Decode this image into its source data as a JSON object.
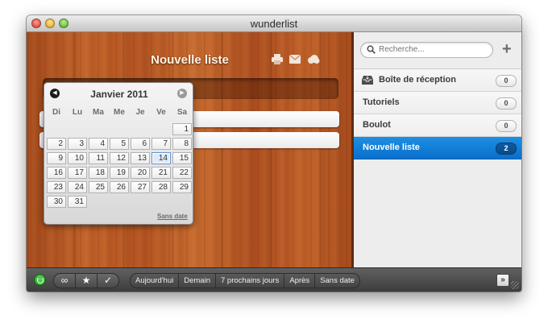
{
  "window": {
    "title": "wunderlist"
  },
  "list": {
    "title": "Nouvelle liste"
  },
  "toolbar_icons": [
    "print-icon",
    "mail-icon",
    "cloud-icon"
  ],
  "search": {
    "placeholder": "Recherche..."
  },
  "sidebar": {
    "items": [
      {
        "label": "Boîte de réception",
        "count": "0",
        "icon": "inbox-icon"
      },
      {
        "label": "Tutoriels",
        "count": "0"
      },
      {
        "label": "Boulot",
        "count": "0"
      },
      {
        "label": "Nouvelle liste",
        "count": "2",
        "active": true
      }
    ]
  },
  "calendar": {
    "month_label": "Janvier 2011",
    "weekdays": [
      "Di",
      "Lu",
      "Ma",
      "Me",
      "Je",
      "Ve",
      "Sa"
    ],
    "days": [
      "1",
      "2",
      "3",
      "4",
      "5",
      "6",
      "7",
      "8",
      "9",
      "10",
      "11",
      "12",
      "13",
      "14",
      "15",
      "16",
      "17",
      "18",
      "19",
      "20",
      "21",
      "22",
      "23",
      "24",
      "25",
      "26",
      "27",
      "28",
      "29",
      "30",
      "31"
    ],
    "today": "14",
    "no_date_label": "Sans date"
  },
  "bottombar": {
    "icons": [
      "sync-icon",
      "infinity-icon",
      "star-icon",
      "check-icon"
    ],
    "filters": [
      "Aujourd'hui",
      "Demain",
      "7 prochains jours",
      "Après",
      "Sans date"
    ],
    "expand_label": "»"
  },
  "colors": {
    "accent": "#0f7fd6",
    "wood": "#b85a26"
  }
}
